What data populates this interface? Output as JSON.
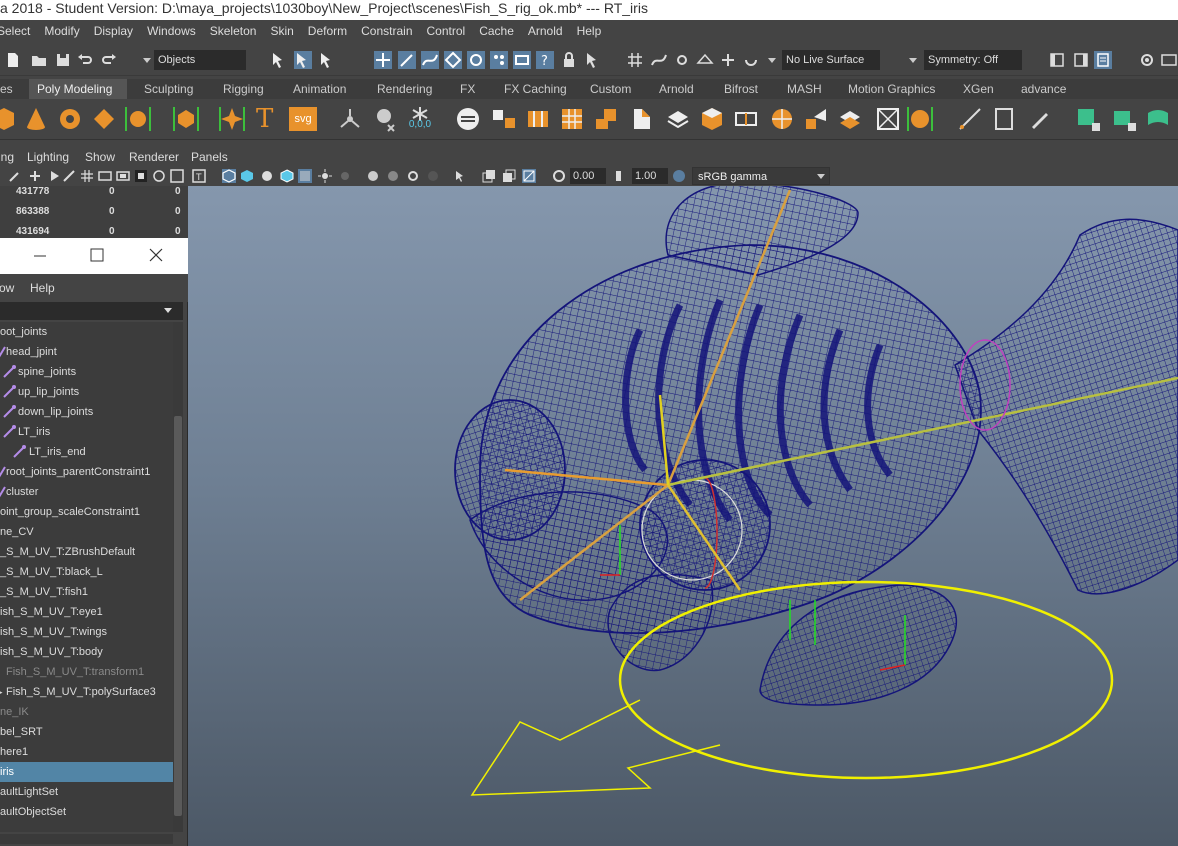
{
  "window": {
    "title": "a 2018 - Student Version: D:\\maya_projects\\1030boy\\New_Project\\scenes\\Fish_S_rig_ok.mb*   ---   RT_iris"
  },
  "menubar": {
    "items": [
      "Select",
      "Modify",
      "Display",
      "Windows",
      "Skeleton",
      "Skin",
      "Deform",
      "Constrain",
      "Control",
      "Cache",
      "Arnold",
      "Help"
    ]
  },
  "statusline": {
    "selection_mode": "Objects",
    "live_surface": "No Live Surface",
    "symmetry": "Symmetry: Off"
  },
  "shelf": {
    "tabs": [
      "es",
      "Poly Modeling",
      "Sculpting",
      "Rigging",
      "Animation",
      "Rendering",
      "FX",
      "FX Caching",
      "Custom",
      "Arnold",
      "Bifrost",
      "MASH",
      "Motion Graphics",
      "XGen",
      "advance"
    ],
    "active_tab": "Poly Modeling",
    "text_icon": "T",
    "svg_icon": "svg",
    "coords_icon": "0,0,0"
  },
  "panel": {
    "menu": [
      "ing",
      "Lighting",
      "Show",
      "Renderer",
      "Panels"
    ],
    "exposure": "0.00",
    "gamma": "1.00",
    "color_space": "sRGB gamma"
  },
  "channelbox": {
    "rows": [
      {
        "value": "431778",
        "a": "0",
        "b": "0"
      },
      {
        "value": "863388",
        "a": "0",
        "b": "0"
      },
      {
        "value": "431694",
        "a": "0",
        "b": "0"
      }
    ]
  },
  "outliner": {
    "menu": [
      "ow",
      "Help"
    ],
    "items": [
      {
        "label": "oot_joints"
      },
      {
        "label": "head_jpint"
      },
      {
        "label": "spine_joints"
      },
      {
        "label": "up_lip_joints"
      },
      {
        "label": "down_lip_joints"
      },
      {
        "label": "LT_iris"
      },
      {
        "label": "LT_iris_end"
      },
      {
        "label": "root_joints_parentConstraint1"
      },
      {
        "label": "cluster"
      },
      {
        "label": "oint_group_scaleConstraint1"
      },
      {
        "label": "ne_CV"
      },
      {
        "label": "_S_M_UV_T:ZBrushDefault"
      },
      {
        "label": "_S_M_UV_T:black_L"
      },
      {
        "label": "_S_M_UV_T:fish1"
      },
      {
        "label": "ish_S_M_UV_T:eye1"
      },
      {
        "label": "ish_S_M_UV_T:wings"
      },
      {
        "label": "ish_S_M_UV_T:body"
      },
      {
        "label": "Fish_S_M_UV_T:transform1"
      },
      {
        "label": "Fish_S_M_UV_T:polySurface3"
      },
      {
        "label": "ne_IK"
      },
      {
        "label": "bel_SRT"
      },
      {
        "label": "here1"
      },
      {
        "label": "iris"
      },
      {
        "label": "aultLightSet"
      },
      {
        "label": "aultObjectSet"
      }
    ]
  },
  "colors": {
    "accent": "#5285a6",
    "wireframe": "#14147a",
    "yellow_control": "#f0f000"
  }
}
